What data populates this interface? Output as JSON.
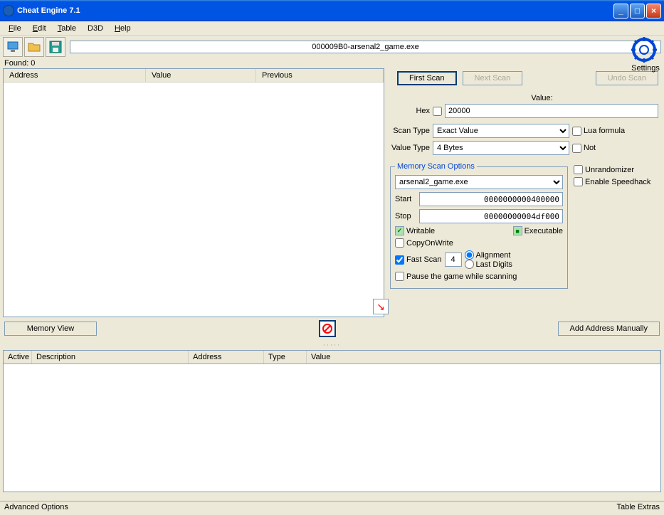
{
  "window": {
    "title": "Cheat Engine 7.1"
  },
  "menu": {
    "file": "File",
    "edit": "Edit",
    "table": "Table",
    "d3d": "D3D",
    "help": "Help"
  },
  "toolbar": {
    "process": "000009B0-arsenal2_game.exe"
  },
  "settings_label": "Settings",
  "found": "Found: 0",
  "results": {
    "address": "Address",
    "value": "Value",
    "previous": "Previous"
  },
  "scan": {
    "first": "First Scan",
    "next": "Next Scan",
    "undo": "Undo Scan",
    "value_label": "Value:",
    "hex_label": "Hex",
    "value": "20000",
    "scantype_label": "Scan Type",
    "scantype": "Exact Value",
    "valuetype_label": "Value Type",
    "valuetype": "4 Bytes",
    "lua": "Lua formula",
    "not": "Not"
  },
  "memopts": {
    "legend": "Memory Scan Options",
    "process": "arsenal2_game.exe",
    "start_label": "Start",
    "start": "0000000000400000",
    "stop_label": "Stop",
    "stop": "00000000004df000",
    "writable": "Writable",
    "executable": "Executable",
    "cow": "CopyOnWrite",
    "fastscan": "Fast Scan",
    "fastscan_val": "4",
    "alignment": "Alignment",
    "lastdigits": "Last Digits",
    "pause": "Pause the game while scanning"
  },
  "right": {
    "unrandomizer": "Unrandomizer",
    "speedhack": "Enable Speedhack"
  },
  "buttons": {
    "memview": "Memory View",
    "addmanual": "Add Address Manually"
  },
  "table": {
    "active": "Active",
    "desc": "Description",
    "addr": "Address",
    "type": "Type",
    "value": "Value"
  },
  "status": {
    "advopt": "Advanced Options",
    "extras": "Table Extras"
  }
}
